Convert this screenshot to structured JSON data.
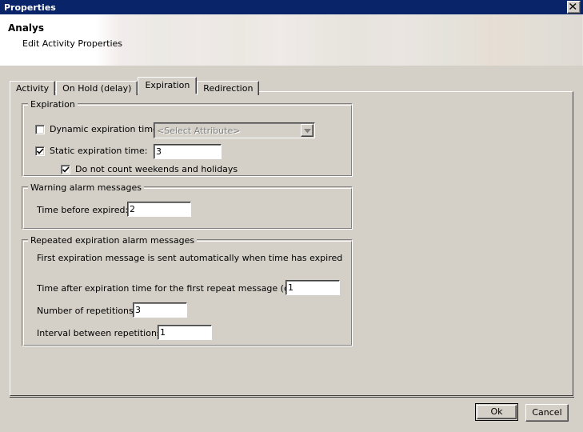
{
  "window": {
    "title": "Properties",
    "close_icon": "close-icon"
  },
  "banner": {
    "title": "Analys",
    "subtitle": "Edit Activity Properties"
  },
  "tabs": [
    {
      "label": "Activity",
      "selected": false
    },
    {
      "label": "On Hold (delay)",
      "selected": false
    },
    {
      "label": "Expiration",
      "selected": true
    },
    {
      "label": "Redirection",
      "selected": false
    }
  ],
  "expiration_group": {
    "legend": "Expiration",
    "dynamic": {
      "label": "Dynamic expiration time:",
      "checked": false,
      "combo_value": "<Select Attribute>",
      "combo_disabled": true
    },
    "static": {
      "label": "Static expiration time:",
      "checked": true,
      "value": "3"
    },
    "weekends": {
      "label": "Do not count weekends and holidays",
      "checked": true
    }
  },
  "warning_group": {
    "legend": "Warning alarm messages",
    "time_before_expired": {
      "label": "Time before expired:",
      "value": "2"
    }
  },
  "repeated_group": {
    "legend": "Repeated expiration alarm messages",
    "note": "First expiration message is sent automatically when time has expired",
    "first_repeat": {
      "label": "Time after expiration time for the first repeat message (days):",
      "value": "1"
    },
    "repetitions": {
      "label": "Number of repetitions:",
      "value": "3"
    },
    "interval": {
      "label": "Interval between repetitions:",
      "value": "1"
    }
  },
  "footer": {
    "ok_label": "Ok",
    "cancel_label": "Cancel"
  },
  "colors": {
    "titlebar": "#0a246a",
    "dialog_face": "#d4d0c8",
    "field_bg": "#ffffff",
    "disabled_text": "#808080"
  }
}
